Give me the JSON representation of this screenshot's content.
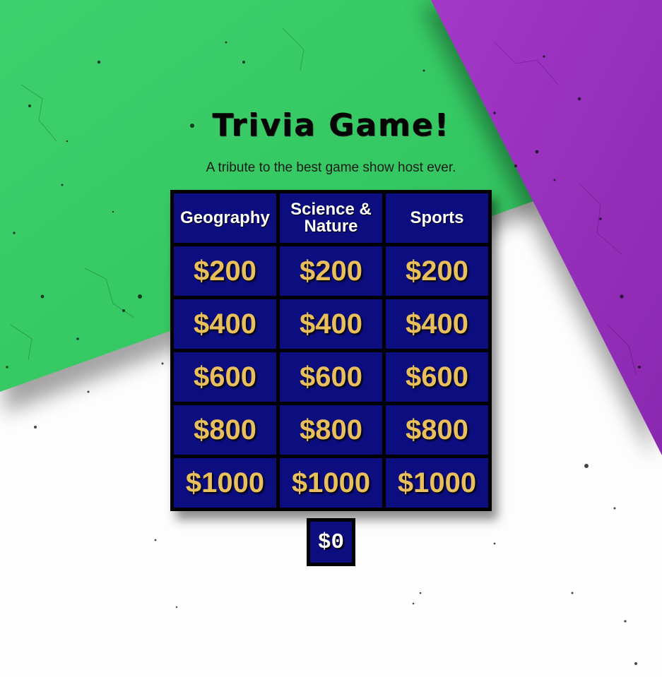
{
  "header": {
    "title": "Trivia Game!",
    "subtitle": "A tribute to the best game show host ever."
  },
  "board": {
    "categories": [
      "Geography",
      "Science & Nature",
      "Sports"
    ],
    "rows": [
      [
        "$200",
        "$200",
        "$200"
      ],
      [
        "$400",
        "$400",
        "$400"
      ],
      [
        "$600",
        "$600",
        "$600"
      ],
      [
        "$800",
        "$800",
        "$800"
      ],
      [
        "$1000",
        "$1000",
        "$1000"
      ]
    ]
  },
  "score": {
    "value": "$0"
  },
  "colors": {
    "board_blue": "#0c0d7e",
    "value_gold": "#e8bf5c",
    "green": "#33cc66",
    "purple": "#9b2fbf",
    "white": "#ffffff"
  }
}
